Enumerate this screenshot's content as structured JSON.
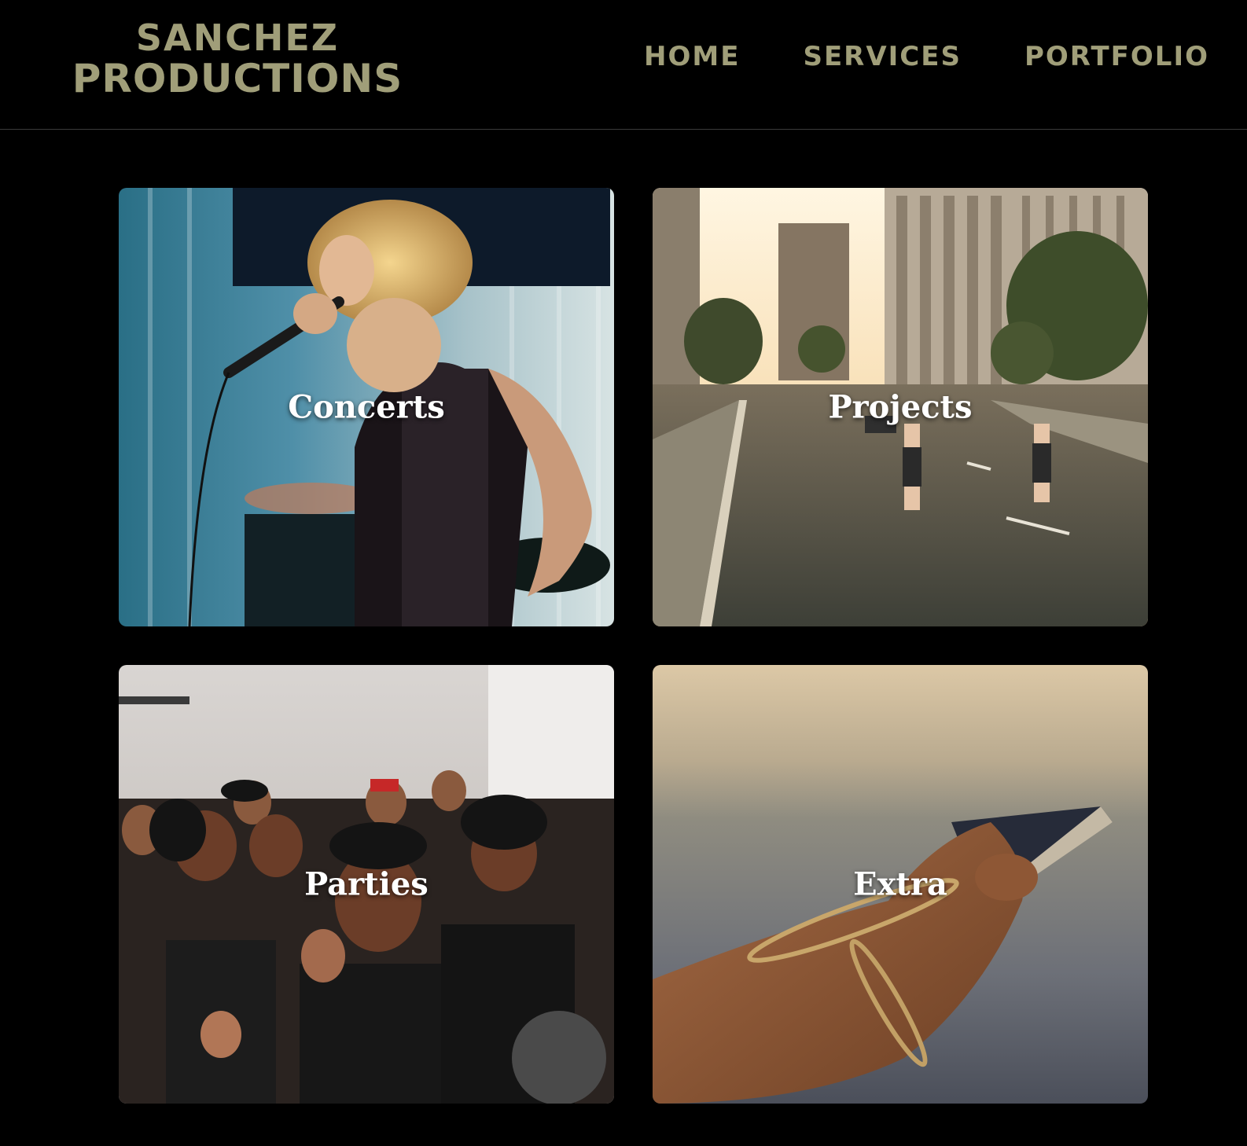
{
  "brand": {
    "line1": "SANCHEZ",
    "line2": "PRODUCTIONS",
    "color": "#a09e79"
  },
  "nav": {
    "items": [
      {
        "label": "HOME"
      },
      {
        "label": "SERVICES"
      },
      {
        "label": "PORTFOLIO"
      }
    ]
  },
  "gallery": {
    "cards": [
      {
        "label": "Concerts",
        "image": "singer-performing-on-stage-photo"
      },
      {
        "label": "Projects",
        "image": "city-street-sunset-photo"
      },
      {
        "label": "Parties",
        "image": "crowd-at-party-photo"
      },
      {
        "label": "Extra",
        "image": "hand-holding-phone-photo"
      }
    ]
  }
}
